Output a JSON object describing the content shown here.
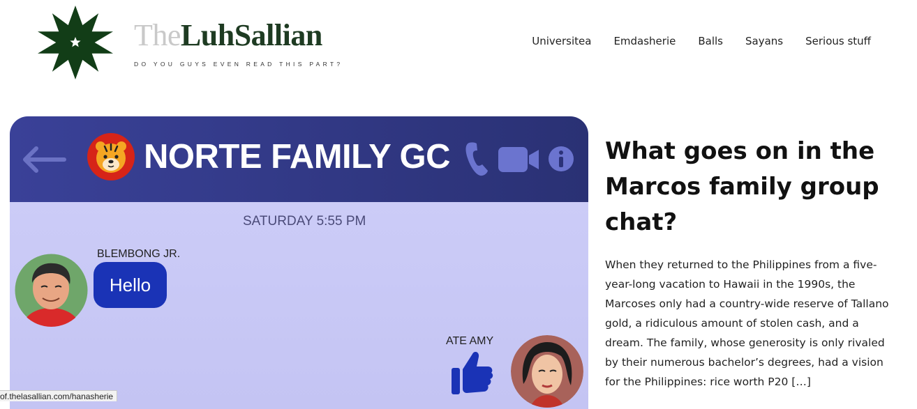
{
  "site": {
    "brand_prefix": "The",
    "brand_name": "LuhSallian",
    "tagline": "DO YOU GUYS EVEN READ THIS PART?",
    "brand_color": "#1e3b22"
  },
  "nav": {
    "items": [
      {
        "label": "Universitea"
      },
      {
        "label": "Emdasherie"
      },
      {
        "label": "Balls"
      },
      {
        "label": "Sayans"
      },
      {
        "label": "Serious stuff"
      }
    ]
  },
  "featured_image": {
    "chat_title": "NORTE FAMILY GC",
    "timestamp": "SATURDAY 5:55 PM",
    "sender_1": "BLEMBONG JR.",
    "message_1": "Hello",
    "sender_2": "ATE AMY",
    "icons": [
      "back-arrow-icon",
      "tiger-icon",
      "phone-icon",
      "video-icon",
      "info-icon",
      "thumbs-up-icon"
    ],
    "header_color": "#323a86",
    "bubble_color": "#1a33b6"
  },
  "article": {
    "title": "What goes on in the Marcos family group chat?",
    "excerpt": "When they returned to the Philippines from a five-year-long vacation to Hawaii in the 1990s, the Marcoses only had a country-wide reserve of Tallano gold, a ridiculous amount of stolen cash, and a dream. The family, whose generosity is only rivaled by their numerous bachelor’s degrees, had a vision for the Philippines: rice worth P20 […]"
  },
  "status_bar": {
    "url": "of.thelasallian.com/hanasherie"
  }
}
